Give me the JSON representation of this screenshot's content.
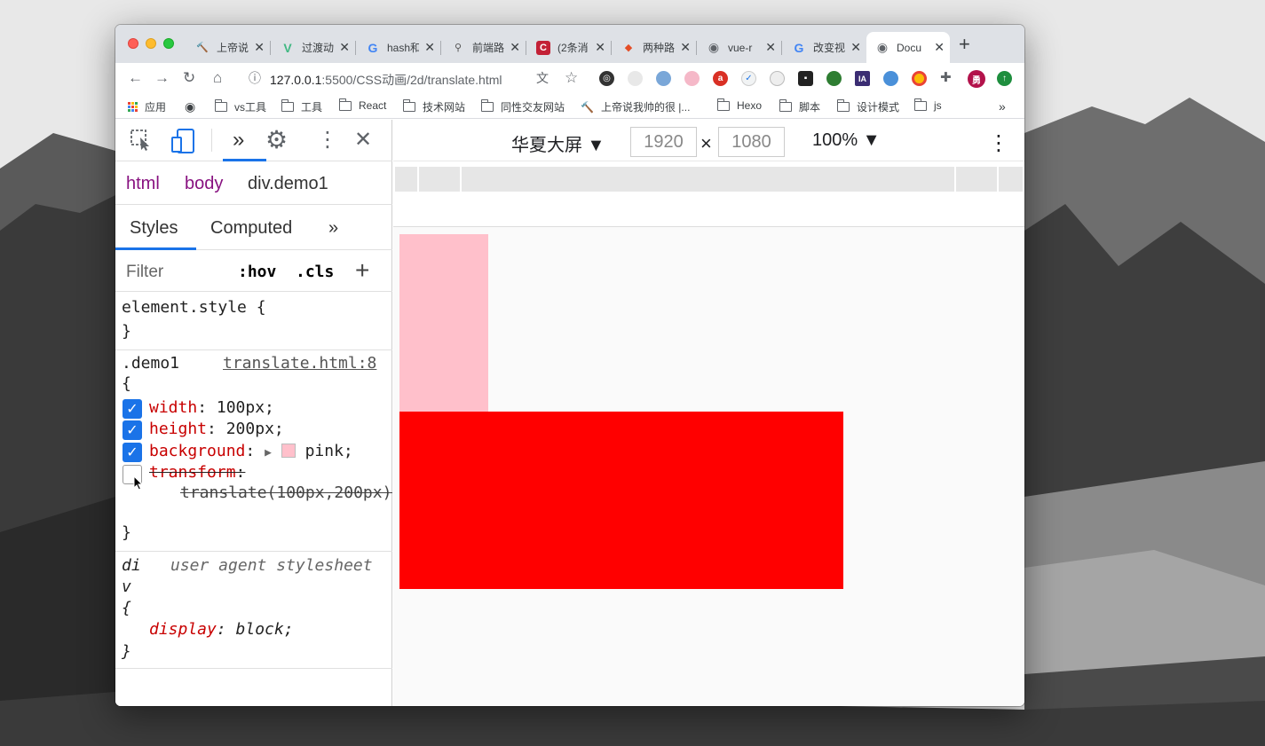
{
  "browser": {
    "tabs": [
      {
        "title": "上帝说",
        "favicon_color": "#1b2a6b",
        "favicon": "🔨"
      },
      {
        "title": "过渡动",
        "favicon_color": "#41b883",
        "favicon": "V"
      },
      {
        "title": "hash和",
        "favicon_color": "#4285f4",
        "favicon": "G"
      },
      {
        "title": "前端路",
        "favicon_color": "#555555",
        "favicon": "⚲"
      },
      {
        "title": "(2条消",
        "favicon_color": "#c32136",
        "favicon": "C"
      },
      {
        "title": "两种路",
        "favicon_color": "#e44d26",
        "favicon": "◆"
      },
      {
        "title": "vue-r",
        "favicon_color": "#5f6368",
        "favicon": "◉"
      },
      {
        "title": "改变视",
        "favicon_color": "#4285f4",
        "favicon": "G"
      },
      {
        "title": "Docu",
        "favicon_color": "#5f6368",
        "favicon": "◉",
        "active": true
      }
    ],
    "new_tab": "+",
    "url_host": "127.0.0.1",
    "url_rest": ":5500/CSS动画/2d/translate.html",
    "bookmarks": [
      {
        "label": "应用",
        "type": "apps"
      },
      {
        "label": "",
        "type": "globe"
      },
      {
        "label": "vs工具",
        "type": "folder"
      },
      {
        "label": "工具",
        "type": "folder"
      },
      {
        "label": "React",
        "type": "folder"
      },
      {
        "label": "技术网站",
        "type": "folder"
      },
      {
        "label": "同性交友网站",
        "type": "folder"
      },
      {
        "label": "上帝说我帅的很 |...",
        "type": "link"
      },
      {
        "label": "Hexo",
        "type": "folder"
      },
      {
        "label": "脚本",
        "type": "folder"
      },
      {
        "label": "设计模式",
        "type": "folder"
      },
      {
        "label": "js",
        "type": "folder"
      }
    ],
    "bookmarks_more": "»",
    "extension_avatar": "勇"
  },
  "devtools": {
    "breadcrumbs": [
      "html",
      "body",
      "div.demo1"
    ],
    "subtabs": [
      "Styles",
      "Computed"
    ],
    "more": "»",
    "filter_placeholder": "Filter",
    "hov": ":hov",
    "cls": ".cls",
    "add": "+",
    "element_style_open": "element.style {",
    "close_brace": "}",
    "open_brace": "{",
    "rule_selector": ".demo1",
    "rule_source": "translate.html:8",
    "declarations": [
      {
        "prop": "width",
        "value": "100px;",
        "enabled": true
      },
      {
        "prop": "height",
        "value": "200px;",
        "enabled": true
      },
      {
        "prop": "background",
        "value": "pink;",
        "enabled": true,
        "swatch": "#ffc0cb"
      },
      {
        "prop": "transform",
        "value": "translate(100px,200px);",
        "enabled": false
      }
    ],
    "ua_selector_1": "di",
    "ua_selector_2": "v",
    "ua_label": "user agent stylesheet",
    "ua_prop": "display",
    "ua_value": "block;"
  },
  "device_toolbar": {
    "device": "华夏大屏 ▼",
    "width": "1920",
    "times": "×",
    "height": "1080",
    "zoom": "100% ▼",
    "menu": "⋮"
  },
  "page": {
    "demo_box_color": "#ffc0cb",
    "translated_box_color": "#ff0000"
  }
}
